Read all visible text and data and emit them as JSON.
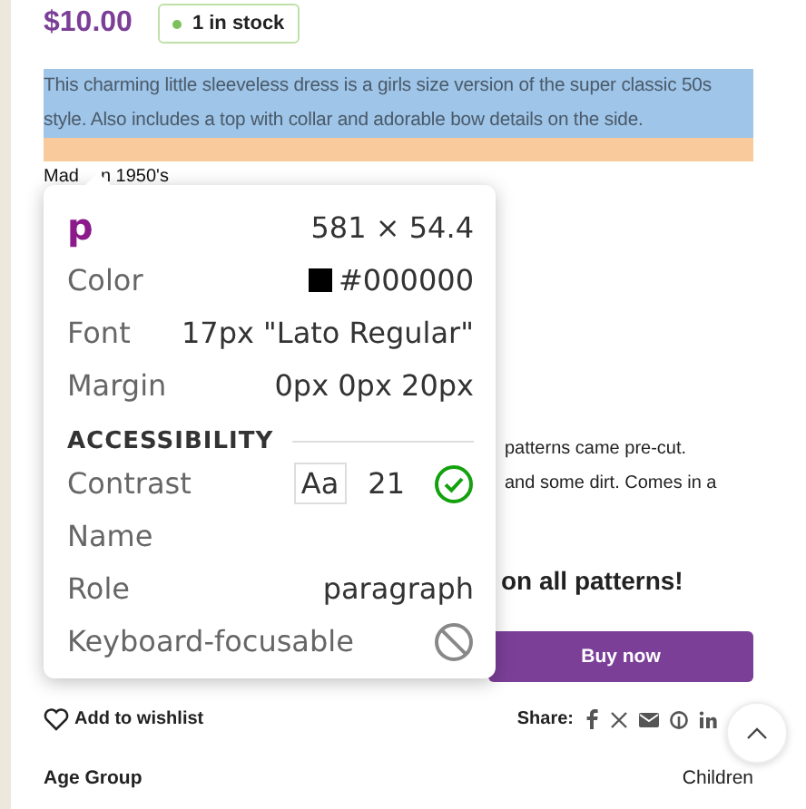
{
  "product": {
    "price": "$10.00",
    "stock": "1 in stock",
    "in_stock": true,
    "description": "This charming little sleeveless dress is a girls size version of the super classic 50s style. Also includes a top with collar and adorable bow details on the side.",
    "made_parts": [
      "Mad",
      "n 1950's"
    ],
    "partial_lines": [
      "patterns came pre-cut.",
      "and some dirt. Comes in a"
    ],
    "promo": "on all patterns!",
    "buy_button": "Buy now",
    "wishlist": "Add to wishlist",
    "share_label": "Share:",
    "attribute": {
      "name": "Age Group",
      "value": "Children"
    }
  },
  "inspector": {
    "tag": "p",
    "size": "581 × 54.4",
    "rows": [
      {
        "label": "Color",
        "value": "#000000",
        "kind": "color"
      },
      {
        "label": "Font",
        "value": "17px \"Lato Regular\""
      },
      {
        "label": "Margin",
        "value": "0px 0px 20px"
      }
    ],
    "section": "ACCESSIBILITY",
    "a11y": [
      {
        "kind": "contrast",
        "label": "Contrast",
        "sample": "Aa",
        "value": "21",
        "passes": true
      },
      {
        "kind": "empty",
        "label": "Name"
      },
      {
        "kind": "text",
        "label": "Role",
        "value": "paragraph"
      },
      {
        "kind": "focus",
        "label": "Keyboard-focusable",
        "focusable": false
      }
    ]
  }
}
